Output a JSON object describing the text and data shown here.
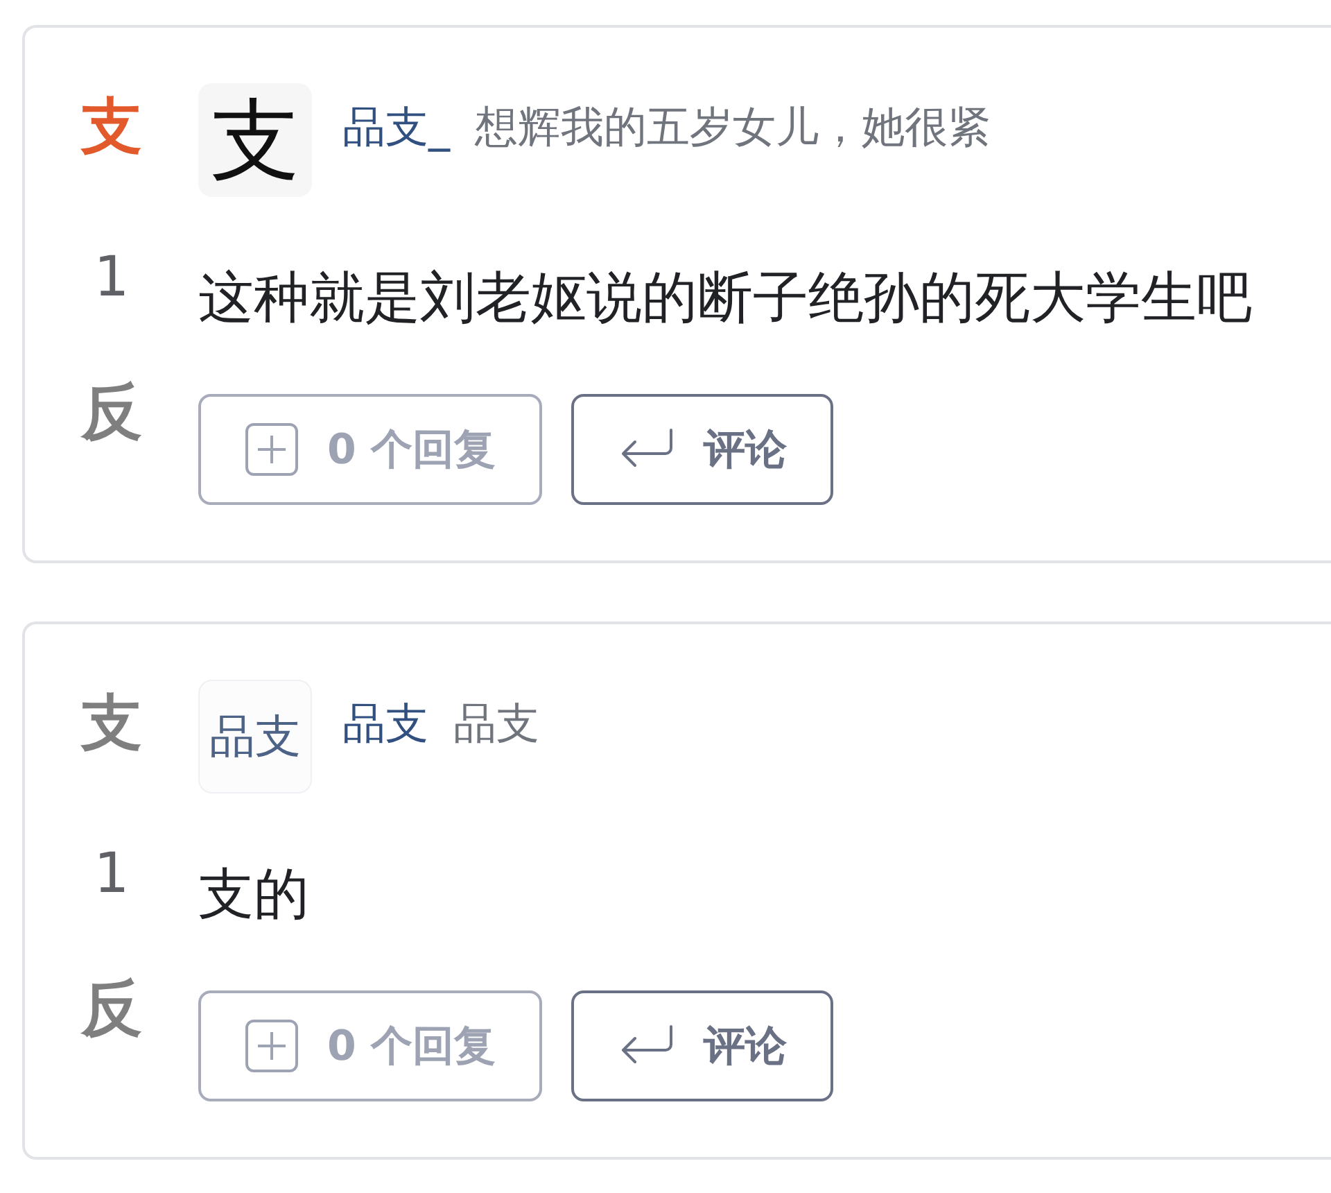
{
  "comments": [
    {
      "support": {
        "label": "支",
        "selected": true
      },
      "score": "1",
      "oppose": {
        "label": "反",
        "selected": false
      },
      "avatar": {
        "kind": "calligraphy",
        "text": "支"
      },
      "author": "品支_",
      "bio": "想辉我的五岁女儿，她很紧",
      "text": "这种就是刘老妪说的断子绝孙的死大学生吧",
      "replies_button": {
        "label": "0 个回复",
        "disabled": true
      },
      "comment_button": {
        "label": "评论",
        "disabled": false
      }
    },
    {
      "support": {
        "label": "支",
        "selected": false
      },
      "score": "1",
      "oppose": {
        "label": "反",
        "selected": false
      },
      "avatar": {
        "kind": "text",
        "text": "品支"
      },
      "author": "品支",
      "bio": "品支",
      "text": "支的",
      "replies_button": {
        "label": "0 个回复",
        "disabled": true
      },
      "comment_button": {
        "label": "评论",
        "disabled": false
      }
    }
  ]
}
